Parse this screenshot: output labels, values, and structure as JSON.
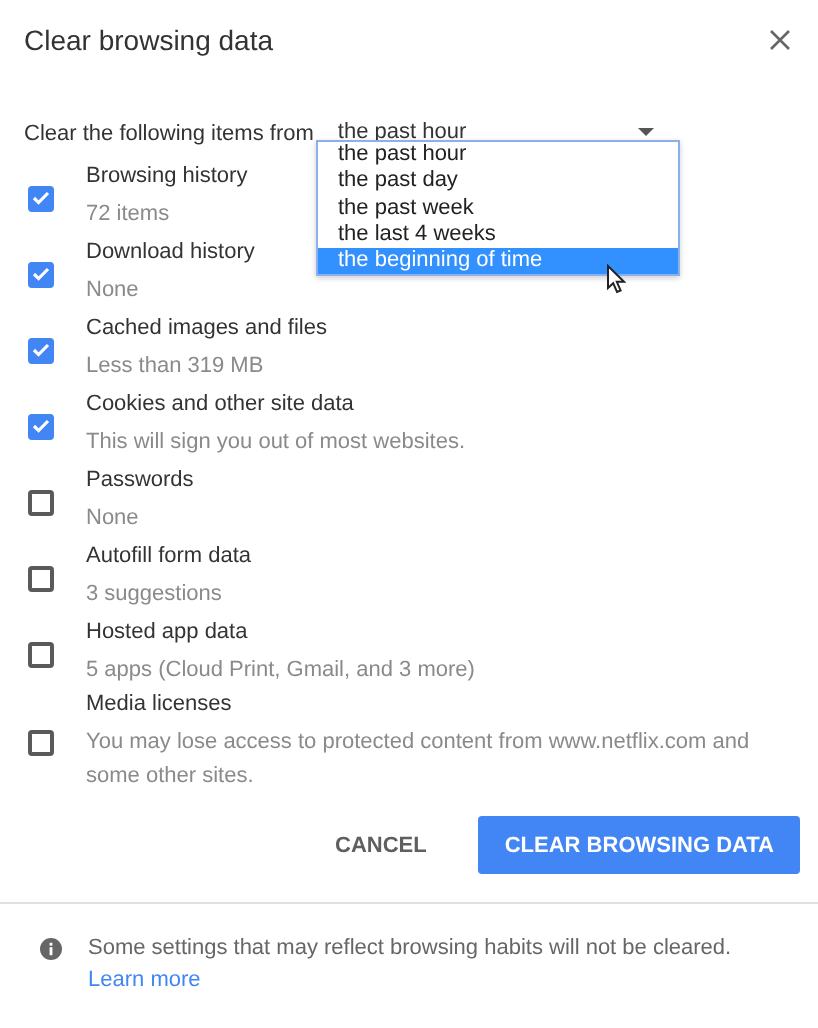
{
  "title": "Clear browsing data",
  "time_range": {
    "label": "Clear the following items from",
    "value": "the past hour",
    "options": [
      {
        "label": "the past hour",
        "highlighted": false
      },
      {
        "label": "the past day",
        "highlighted": false
      },
      {
        "label": "the past week",
        "highlighted": false
      },
      {
        "label": "the last 4 weeks",
        "highlighted": false
      },
      {
        "label": "the beginning of time",
        "highlighted": true
      }
    ]
  },
  "items": [
    {
      "label": "Browsing history",
      "detail": "72 items",
      "checked": true
    },
    {
      "label": "Download history",
      "detail": "None",
      "checked": true
    },
    {
      "label": "Cached images and files",
      "detail": "Less than 319 MB",
      "checked": true
    },
    {
      "label": "Cookies and other site data",
      "detail": "This will sign you out of most websites.",
      "checked": true
    },
    {
      "label": "Passwords",
      "detail": "None",
      "checked": false
    },
    {
      "label": "Autofill form data",
      "detail": "3 suggestions",
      "checked": false
    },
    {
      "label": "Hosted app data",
      "detail": "5 apps (Cloud Print, Gmail, and 3 more)",
      "checked": false
    },
    {
      "label": "Media licenses",
      "detail": "You may lose access to protected content from www.netflix.com and some other sites.",
      "checked": false
    }
  ],
  "buttons": [
    {
      "label": "CANCEL",
      "kind": "secondary"
    },
    {
      "label": "CLEAR BROWSING DATA",
      "kind": "primary"
    }
  ],
  "footer": {
    "text": "Some settings that may reflect browsing habits will not be cleared.",
    "link": "Learn more"
  }
}
